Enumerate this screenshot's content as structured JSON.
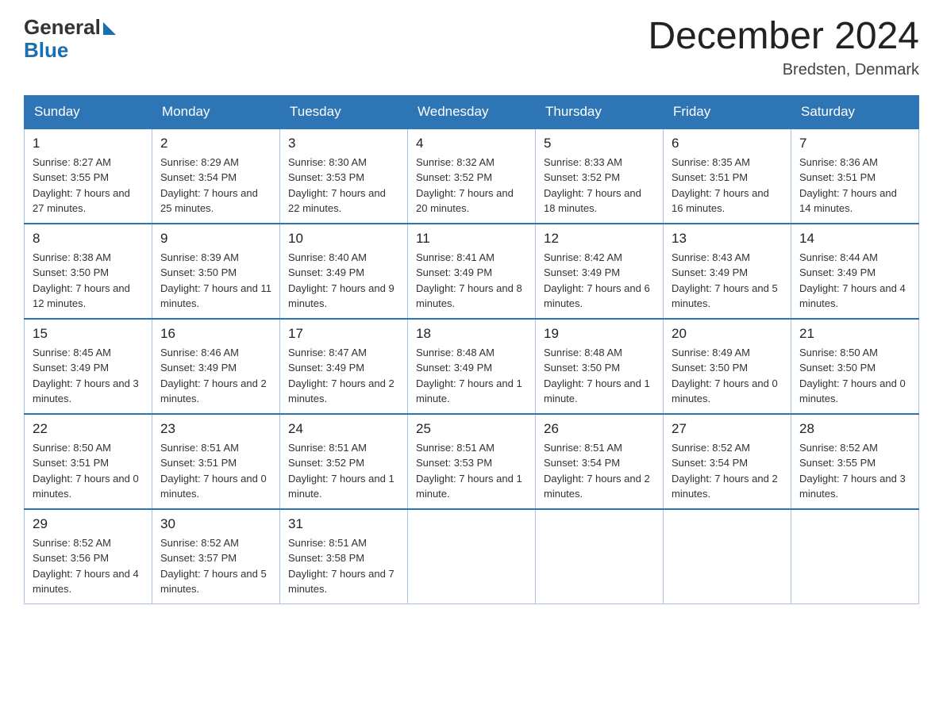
{
  "header": {
    "logo_text_general": "General",
    "logo_text_blue": "Blue",
    "month_title": "December 2024",
    "location": "Bredsten, Denmark"
  },
  "days_of_week": [
    "Sunday",
    "Monday",
    "Tuesday",
    "Wednesday",
    "Thursday",
    "Friday",
    "Saturday"
  ],
  "weeks": [
    [
      {
        "num": "1",
        "sunrise": "8:27 AM",
        "sunset": "3:55 PM",
        "daylight": "7 hours and 27 minutes."
      },
      {
        "num": "2",
        "sunrise": "8:29 AM",
        "sunset": "3:54 PM",
        "daylight": "7 hours and 25 minutes."
      },
      {
        "num": "3",
        "sunrise": "8:30 AM",
        "sunset": "3:53 PM",
        "daylight": "7 hours and 22 minutes."
      },
      {
        "num": "4",
        "sunrise": "8:32 AM",
        "sunset": "3:52 PM",
        "daylight": "7 hours and 20 minutes."
      },
      {
        "num": "5",
        "sunrise": "8:33 AM",
        "sunset": "3:52 PM",
        "daylight": "7 hours and 18 minutes."
      },
      {
        "num": "6",
        "sunrise": "8:35 AM",
        "sunset": "3:51 PM",
        "daylight": "7 hours and 16 minutes."
      },
      {
        "num": "7",
        "sunrise": "8:36 AM",
        "sunset": "3:51 PM",
        "daylight": "7 hours and 14 minutes."
      }
    ],
    [
      {
        "num": "8",
        "sunrise": "8:38 AM",
        "sunset": "3:50 PM",
        "daylight": "7 hours and 12 minutes."
      },
      {
        "num": "9",
        "sunrise": "8:39 AM",
        "sunset": "3:50 PM",
        "daylight": "7 hours and 11 minutes."
      },
      {
        "num": "10",
        "sunrise": "8:40 AM",
        "sunset": "3:49 PM",
        "daylight": "7 hours and 9 minutes."
      },
      {
        "num": "11",
        "sunrise": "8:41 AM",
        "sunset": "3:49 PM",
        "daylight": "7 hours and 8 minutes."
      },
      {
        "num": "12",
        "sunrise": "8:42 AM",
        "sunset": "3:49 PM",
        "daylight": "7 hours and 6 minutes."
      },
      {
        "num": "13",
        "sunrise": "8:43 AM",
        "sunset": "3:49 PM",
        "daylight": "7 hours and 5 minutes."
      },
      {
        "num": "14",
        "sunrise": "8:44 AM",
        "sunset": "3:49 PM",
        "daylight": "7 hours and 4 minutes."
      }
    ],
    [
      {
        "num": "15",
        "sunrise": "8:45 AM",
        "sunset": "3:49 PM",
        "daylight": "7 hours and 3 minutes."
      },
      {
        "num": "16",
        "sunrise": "8:46 AM",
        "sunset": "3:49 PM",
        "daylight": "7 hours and 2 minutes."
      },
      {
        "num": "17",
        "sunrise": "8:47 AM",
        "sunset": "3:49 PM",
        "daylight": "7 hours and 2 minutes."
      },
      {
        "num": "18",
        "sunrise": "8:48 AM",
        "sunset": "3:49 PM",
        "daylight": "7 hours and 1 minute."
      },
      {
        "num": "19",
        "sunrise": "8:48 AM",
        "sunset": "3:50 PM",
        "daylight": "7 hours and 1 minute."
      },
      {
        "num": "20",
        "sunrise": "8:49 AM",
        "sunset": "3:50 PM",
        "daylight": "7 hours and 0 minutes."
      },
      {
        "num": "21",
        "sunrise": "8:50 AM",
        "sunset": "3:50 PM",
        "daylight": "7 hours and 0 minutes."
      }
    ],
    [
      {
        "num": "22",
        "sunrise": "8:50 AM",
        "sunset": "3:51 PM",
        "daylight": "7 hours and 0 minutes."
      },
      {
        "num": "23",
        "sunrise": "8:51 AM",
        "sunset": "3:51 PM",
        "daylight": "7 hours and 0 minutes."
      },
      {
        "num": "24",
        "sunrise": "8:51 AM",
        "sunset": "3:52 PM",
        "daylight": "7 hours and 1 minute."
      },
      {
        "num": "25",
        "sunrise": "8:51 AM",
        "sunset": "3:53 PM",
        "daylight": "7 hours and 1 minute."
      },
      {
        "num": "26",
        "sunrise": "8:51 AM",
        "sunset": "3:54 PM",
        "daylight": "7 hours and 2 minutes."
      },
      {
        "num": "27",
        "sunrise": "8:52 AM",
        "sunset": "3:54 PM",
        "daylight": "7 hours and 2 minutes."
      },
      {
        "num": "28",
        "sunrise": "8:52 AM",
        "sunset": "3:55 PM",
        "daylight": "7 hours and 3 minutes."
      }
    ],
    [
      {
        "num": "29",
        "sunrise": "8:52 AM",
        "sunset": "3:56 PM",
        "daylight": "7 hours and 4 minutes."
      },
      {
        "num": "30",
        "sunrise": "8:52 AM",
        "sunset": "3:57 PM",
        "daylight": "7 hours and 5 minutes."
      },
      {
        "num": "31",
        "sunrise": "8:51 AM",
        "sunset": "3:58 PM",
        "daylight": "7 hours and 7 minutes."
      },
      null,
      null,
      null,
      null
    ]
  ]
}
